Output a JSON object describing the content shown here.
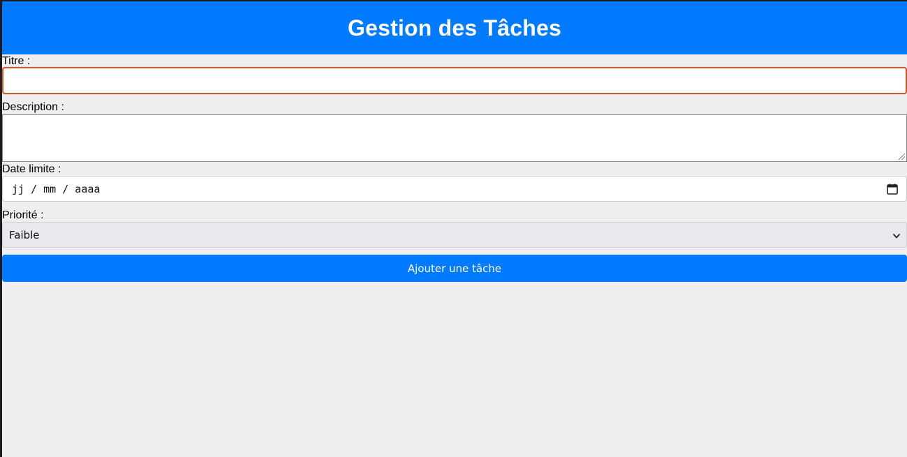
{
  "header": {
    "title": "Gestion des Tâches"
  },
  "form": {
    "title_label": "Titre :",
    "title_value": "",
    "description_label": "Description :",
    "description_value": "",
    "date_label": "Date limite :",
    "date_placeholder": "jj / mm / aaaa",
    "date_icon": "calendar-icon",
    "priority_label": "Priorité :",
    "priority_selected": "Faible",
    "priority_icon": "chevron-down-icon",
    "submit_label": "Ajouter une tâche"
  },
  "colors": {
    "accent": "#007bff",
    "background": "#efefef",
    "focus_border": "#cc5a33"
  }
}
